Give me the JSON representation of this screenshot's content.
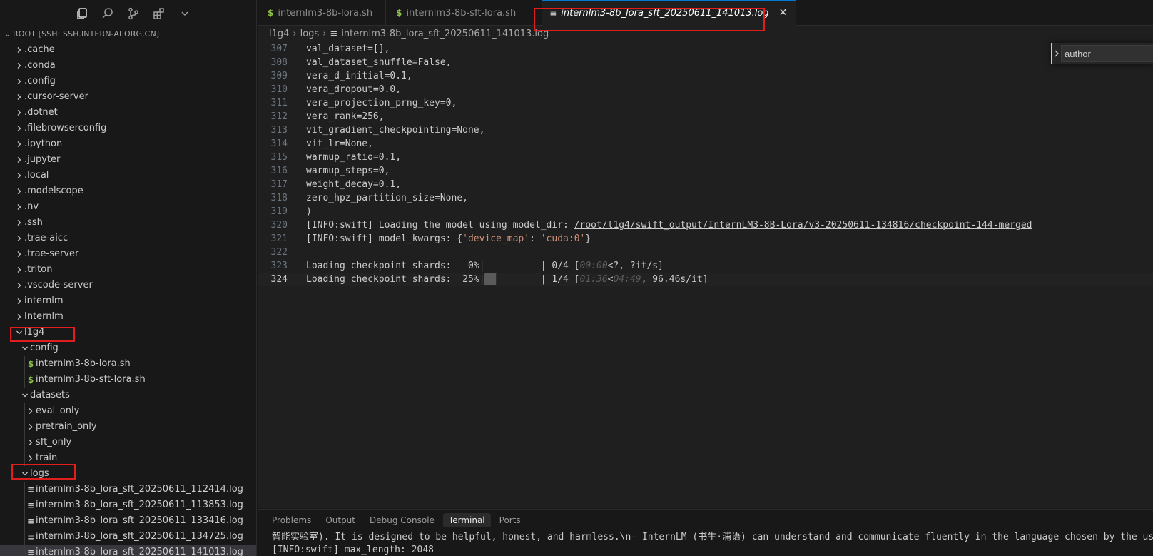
{
  "sidebar": {
    "root_label": "ROOT [SSH: SSH.INTERN-AI.ORG.CN]",
    "activity_icons": [
      "explorer-icon",
      "search-icon",
      "source-control-icon",
      "extensions-icon",
      "chevron-down-icon"
    ],
    "tree": [
      {
        "label": ".cache",
        "kind": "folder",
        "depth": 0,
        "expanded": false
      },
      {
        "label": ".conda",
        "kind": "folder",
        "depth": 0,
        "expanded": false
      },
      {
        "label": ".config",
        "kind": "folder",
        "depth": 0,
        "expanded": false
      },
      {
        "label": ".cursor-server",
        "kind": "folder",
        "depth": 0,
        "expanded": false
      },
      {
        "label": ".dotnet",
        "kind": "folder",
        "depth": 0,
        "expanded": false
      },
      {
        "label": ".filebrowserconfig",
        "kind": "folder",
        "depth": 0,
        "expanded": false
      },
      {
        "label": ".ipython",
        "kind": "folder",
        "depth": 0,
        "expanded": false
      },
      {
        "label": ".jupyter",
        "kind": "folder",
        "depth": 0,
        "expanded": false
      },
      {
        "label": ".local",
        "kind": "folder",
        "depth": 0,
        "expanded": false
      },
      {
        "label": ".modelscope",
        "kind": "folder",
        "depth": 0,
        "expanded": false
      },
      {
        "label": ".nv",
        "kind": "folder",
        "depth": 0,
        "expanded": false
      },
      {
        "label": ".ssh",
        "kind": "folder",
        "depth": 0,
        "expanded": false
      },
      {
        "label": ".trae-aicc",
        "kind": "folder",
        "depth": 0,
        "expanded": false
      },
      {
        "label": ".trae-server",
        "kind": "folder",
        "depth": 0,
        "expanded": false
      },
      {
        "label": ".triton",
        "kind": "folder",
        "depth": 0,
        "expanded": false
      },
      {
        "label": ".vscode-server",
        "kind": "folder",
        "depth": 0,
        "expanded": false
      },
      {
        "label": "internlm",
        "kind": "folder",
        "depth": 0,
        "expanded": false
      },
      {
        "label": "Internlm",
        "kind": "folder",
        "depth": 0,
        "expanded": false
      },
      {
        "label": "l1g4",
        "kind": "folder",
        "depth": 0,
        "expanded": true
      },
      {
        "label": "config",
        "kind": "folder",
        "depth": 1,
        "expanded": true
      },
      {
        "label": "internlm3-8b-lora.sh",
        "kind": "sh",
        "depth": 2
      },
      {
        "label": "internlm3-8b-sft-lora.sh",
        "kind": "sh",
        "depth": 2
      },
      {
        "label": "datasets",
        "kind": "folder",
        "depth": 1,
        "expanded": true
      },
      {
        "label": "eval_only",
        "kind": "folder",
        "depth": 2,
        "expanded": false
      },
      {
        "label": "pretrain_only",
        "kind": "folder",
        "depth": 2,
        "expanded": false
      },
      {
        "label": "sft_only",
        "kind": "folder",
        "depth": 2,
        "expanded": false
      },
      {
        "label": "train",
        "kind": "folder",
        "depth": 2,
        "expanded": false
      },
      {
        "label": "logs",
        "kind": "folder",
        "depth": 1,
        "expanded": true
      },
      {
        "label": "internlm3-8b_lora_sft_20250611_112414.log",
        "kind": "log",
        "depth": 2
      },
      {
        "label": "internlm3-8b_lora_sft_20250611_113853.log",
        "kind": "log",
        "depth": 2
      },
      {
        "label": "internlm3-8b_lora_sft_20250611_133416.log",
        "kind": "log",
        "depth": 2
      },
      {
        "label": "internlm3-8b_lora_sft_20250611_134725.log",
        "kind": "log",
        "depth": 2
      },
      {
        "label": "internlm3-8b_lora_sft_20250611_141013.log",
        "kind": "log",
        "depth": 2,
        "selected": true
      }
    ]
  },
  "tabs": [
    {
      "label": "internlm3-8b-lora.sh",
      "icon": "$",
      "active": false
    },
    {
      "label": "internlm3-8b-sft-lora.sh",
      "icon": "$",
      "active": false
    },
    {
      "label": "internlm3-8b_lora_sft_20250611_141013.log",
      "icon": "≡",
      "active": true,
      "close": "✕"
    }
  ],
  "breadcrumb": {
    "parts": [
      "l1g4",
      "logs"
    ],
    "sep": "›",
    "file_icon": "≡",
    "file": "internlm3-8b_lora_sft_20250611_141013.log"
  },
  "editor": {
    "current_line": 324,
    "lines": [
      {
        "n": 307,
        "segs": [
          {
            "t": "val_dataset=[],"
          }
        ]
      },
      {
        "n": 308,
        "segs": [
          {
            "t": "val_dataset_shuffle=False,"
          }
        ]
      },
      {
        "n": 309,
        "segs": [
          {
            "t": "vera_d_initial=0.1,"
          }
        ]
      },
      {
        "n": 310,
        "segs": [
          {
            "t": "vera_dropout=0.0,"
          }
        ]
      },
      {
        "n": 311,
        "segs": [
          {
            "t": "vera_projection_prng_key=0,"
          }
        ]
      },
      {
        "n": 312,
        "segs": [
          {
            "t": "vera_rank=256,"
          }
        ]
      },
      {
        "n": 313,
        "segs": [
          {
            "t": "vit_gradient_checkpointing=None,"
          }
        ]
      },
      {
        "n": 314,
        "segs": [
          {
            "t": "vit_lr=None,"
          }
        ]
      },
      {
        "n": 315,
        "segs": [
          {
            "t": "warmup_ratio=0.1,"
          }
        ]
      },
      {
        "n": 316,
        "segs": [
          {
            "t": "warmup_steps=0,"
          }
        ]
      },
      {
        "n": 317,
        "segs": [
          {
            "t": "weight_decay=0.1,"
          }
        ]
      },
      {
        "n": 318,
        "segs": [
          {
            "t": "zero_hpz_partition_size=None,"
          }
        ]
      },
      {
        "n": 319,
        "segs": [
          {
            "t": ")"
          }
        ]
      },
      {
        "n": 320,
        "segs": [
          {
            "t": "[INFO:swift] Loading the model using model_dir: "
          },
          {
            "t": "/root/l1g4/swift_output/InternLM3-8B-Lora/v3-20250611-134816/checkpoint-144-merged",
            "c": "path"
          }
        ]
      },
      {
        "n": 321,
        "segs": [
          {
            "t": "[INFO:swift] model_kwargs: {"
          },
          {
            "t": "'device_map'",
            "c": "str"
          },
          {
            "t": ": "
          },
          {
            "t": "'cuda:0'",
            "c": "str"
          },
          {
            "t": "}"
          }
        ]
      },
      {
        "n": 322,
        "segs": []
      },
      {
        "n": 323,
        "segs": [
          {
            "t": "Loading checkpoint shards:   0%|          | 0/4 ["
          },
          {
            "t": "00:00",
            "c": "dim"
          },
          {
            "t": "<?, ?it/s]"
          }
        ]
      },
      {
        "n": 324,
        "segs": [
          {
            "t": "Loading checkpoint shards:  25%|"
          },
          {
            "t": "██",
            "c": "bar"
          },
          {
            "t": "        | 1/4 ["
          },
          {
            "t": "01:36",
            "c": "dim"
          },
          {
            "t": "<"
          },
          {
            "t": "04:49",
            "c": "dim"
          },
          {
            "t": ", 96.46s/it]"
          }
        ]
      }
    ]
  },
  "find_widget": {
    "value": "author",
    "chevron": "chevron-right-icon"
  },
  "panel": {
    "tabs": [
      {
        "label": "Problems",
        "active": false
      },
      {
        "label": "Output",
        "active": false
      },
      {
        "label": "Debug Console",
        "active": false
      },
      {
        "label": "Terminal",
        "active": true
      },
      {
        "label": "Ports",
        "active": false
      }
    ],
    "terminal_lines": [
      "智能实验室). It is designed to be helpful, honest, and harmless.\\n- InternLM (书生·浦语) can understand and communicate fluently in the language chosen by the user such as English",
      "[INFO:swift] max_length: 2048"
    ]
  },
  "colors": {
    "highlight_box": "#e01e1e",
    "sh_icon": "#8dc149",
    "accent": "#0078d4"
  }
}
